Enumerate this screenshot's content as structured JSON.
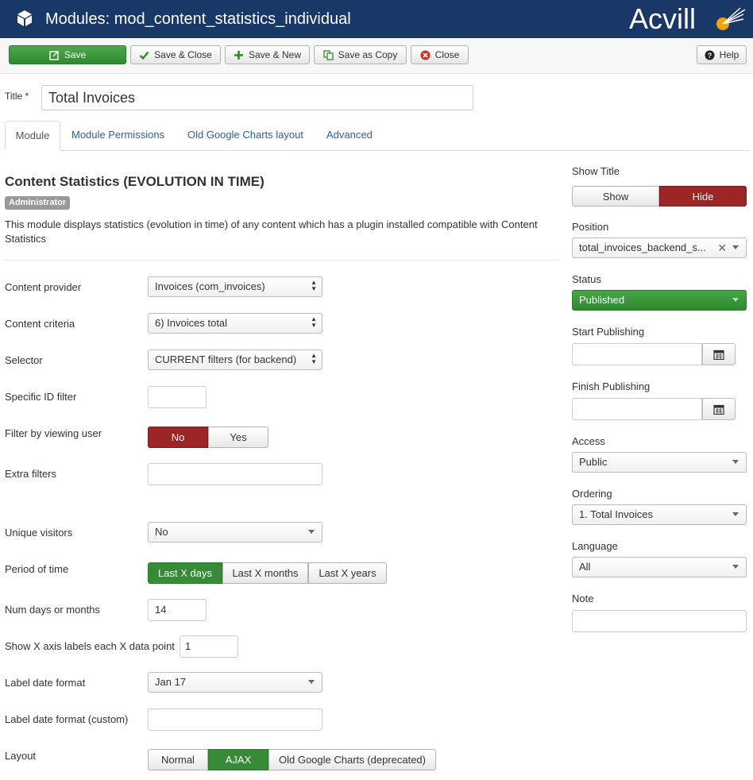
{
  "header": {
    "title": "Modules: mod_content_statistics_individual",
    "brand": "Acvill"
  },
  "toolbar": {
    "save": "Save",
    "save_close": "Save & Close",
    "save_new": "Save & New",
    "save_copy": "Save as Copy",
    "close": "Close",
    "help": "Help"
  },
  "title_field": {
    "label": "Title *",
    "value": "Total Invoices"
  },
  "tabs": [
    {
      "label": "Module"
    },
    {
      "label": "Module Permissions"
    },
    {
      "label": "Old Google Charts layout"
    },
    {
      "label": "Advanced"
    }
  ],
  "module": {
    "heading": "Content Statistics (EVOLUTION IN TIME)",
    "badge": "Administrator",
    "description": "This module displays statistics (evolution in time) of any content which has a plugin installed compatible with Content Statistics"
  },
  "form": {
    "content_provider": {
      "label": "Content provider",
      "value": "Invoices (com_invoices)"
    },
    "content_criteria": {
      "label": "Content criteria",
      "value": "6) Invoices total"
    },
    "selector": {
      "label": "Selector",
      "value": "CURRENT filters (for backend)"
    },
    "specific_id": {
      "label": "Specific ID filter",
      "value": ""
    },
    "filter_user": {
      "label": "Filter by viewing user",
      "no": "No",
      "yes": "Yes"
    },
    "extra_filters": {
      "label": "Extra filters",
      "value": ""
    },
    "unique_visitors": {
      "label": "Unique visitors",
      "value": "No"
    },
    "period": {
      "label": "Period of time",
      "opt1": "Last X days",
      "opt2": "Last X months",
      "opt3": "Last X years"
    },
    "num_days": {
      "label": "Num days or months",
      "value": "14"
    },
    "x_axis": {
      "label": "Show X axis labels each X data point",
      "value": "1"
    },
    "label_format": {
      "label": "Label date format",
      "value": "Jan 17"
    },
    "label_format_custom": {
      "label": "Label date format (custom)",
      "value": ""
    },
    "layout": {
      "label": "Layout",
      "opt1": "Normal",
      "opt2": "AJAX",
      "opt3": "Old Google Charts (deprecated)"
    }
  },
  "sidebar": {
    "show_title": {
      "label": "Show Title",
      "show": "Show",
      "hide": "Hide"
    },
    "position": {
      "label": "Position",
      "value": "total_invoices_backend_s..."
    },
    "status": {
      "label": "Status",
      "value": "Published"
    },
    "start_publishing": {
      "label": "Start Publishing",
      "value": ""
    },
    "finish_publishing": {
      "label": "Finish Publishing",
      "value": ""
    },
    "access": {
      "label": "Access",
      "value": "Public"
    },
    "ordering": {
      "label": "Ordering",
      "value": "1. Total Invoices"
    },
    "language": {
      "label": "Language",
      "value": "All"
    },
    "note": {
      "label": "Note",
      "value": ""
    }
  },
  "colors": {
    "header": "#1a3867",
    "green": "#378a37",
    "red": "#9c2525",
    "link": "#2a6496"
  }
}
